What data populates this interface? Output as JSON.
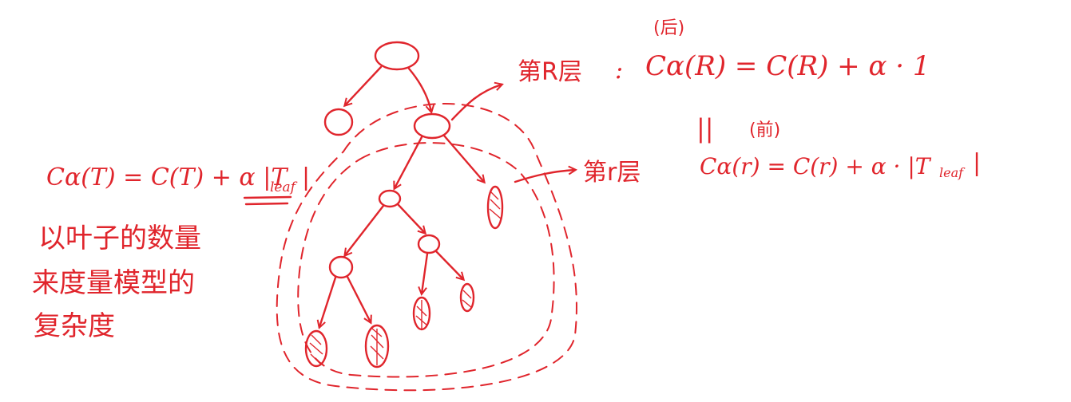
{
  "formulas": {
    "whole_tree": "Cα(T) = C(T) + α |T",
    "whole_tree_sub": "leaf",
    "whole_tree_close": "|",
    "layer_R_label": "第R层",
    "layer_R_colon": ":",
    "layer_R_after": "(后)",
    "layer_R_formula": "Cα(R) = C(R) + α · 1",
    "parallel_mark": "||",
    "layer_r_before": "(前)",
    "layer_r_label": "第r层",
    "layer_r_formula": "Cα(r) = C(r) + α · |T",
    "layer_r_sub": "leaf",
    "layer_r_close": "|"
  },
  "note": {
    "line1": "以叶子的数量",
    "line2": "来度量模型的",
    "line3": "复杂度"
  },
  "colors": {
    "ink": "#e0252c",
    "background": "#ffffff"
  }
}
